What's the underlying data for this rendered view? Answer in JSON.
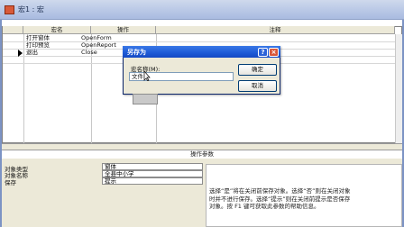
{
  "window": {
    "title": "宏1 : 宏"
  },
  "grid": {
    "columns": [
      "宏名",
      "操作",
      "注释"
    ],
    "rows": [
      {
        "name": "打开窗体",
        "action": "OpenForm",
        "selected": false
      },
      {
        "name": "打印预览",
        "action": "OpenReport",
        "selected": false
      },
      {
        "name": "退出",
        "action": "Close",
        "selected": true
      }
    ]
  },
  "action_params": {
    "heading": "操作参数",
    "fields": [
      {
        "label": "对象类型",
        "value": "窗体"
      },
      {
        "label": "对象名称",
        "value": "全县中小学"
      },
      {
        "label": "保存",
        "value": "提示"
      }
    ],
    "help_text": "选择“是”将在关闭前保存对象。选择“否”则在关闭对象时并不进行保存。选择“提示”则在关闭前提示是否保存对象。按 F1 键可获取此参数的帮助信息。"
  },
  "dialog": {
    "title": "另存为",
    "help_glyph": "?",
    "close_glyph": "×",
    "label": "宏名称(M):",
    "name_value": "文件",
    "ok_label": "确定",
    "cancel_label": "取消"
  },
  "icons": [
    "macro-window-icon",
    "row-selector-arrow-icon",
    "help-icon",
    "close-icon",
    "text-cursor-icon"
  ],
  "colors": {
    "titlebar": "#b9c8e6",
    "dialog_title": "#1d5ad6",
    "close": "#d9573a"
  }
}
